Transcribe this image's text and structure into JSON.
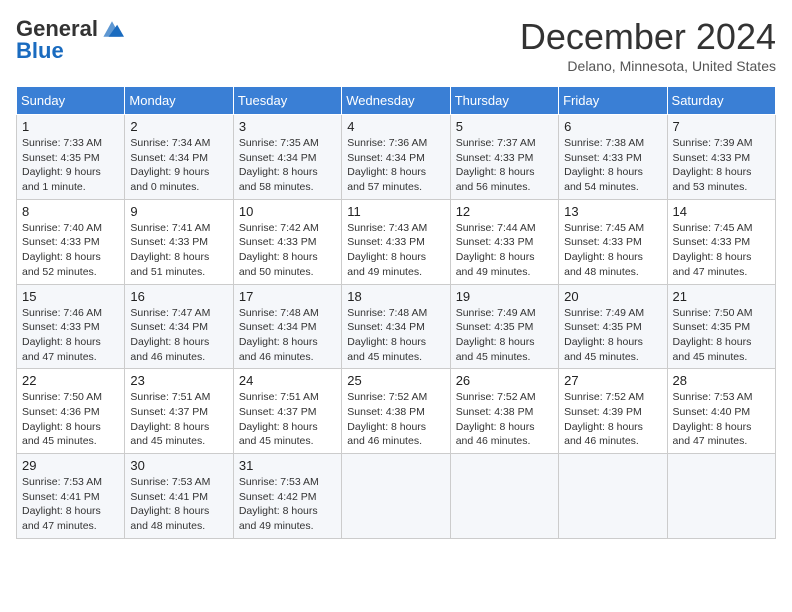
{
  "header": {
    "logo_general": "General",
    "logo_blue": "Blue",
    "month_title": "December 2024",
    "location": "Delano, Minnesota, United States"
  },
  "days_of_week": [
    "Sunday",
    "Monday",
    "Tuesday",
    "Wednesday",
    "Thursday",
    "Friday",
    "Saturday"
  ],
  "weeks": [
    [
      {
        "day": "1",
        "sunrise": "7:33 AM",
        "sunset": "4:35 PM",
        "daylight": "9 hours and 1 minute."
      },
      {
        "day": "2",
        "sunrise": "7:34 AM",
        "sunset": "4:34 PM",
        "daylight": "9 hours and 0 minutes."
      },
      {
        "day": "3",
        "sunrise": "7:35 AM",
        "sunset": "4:34 PM",
        "daylight": "8 hours and 58 minutes."
      },
      {
        "day": "4",
        "sunrise": "7:36 AM",
        "sunset": "4:34 PM",
        "daylight": "8 hours and 57 minutes."
      },
      {
        "day": "5",
        "sunrise": "7:37 AM",
        "sunset": "4:33 PM",
        "daylight": "8 hours and 56 minutes."
      },
      {
        "day": "6",
        "sunrise": "7:38 AM",
        "sunset": "4:33 PM",
        "daylight": "8 hours and 54 minutes."
      },
      {
        "day": "7",
        "sunrise": "7:39 AM",
        "sunset": "4:33 PM",
        "daylight": "8 hours and 53 minutes."
      }
    ],
    [
      {
        "day": "8",
        "sunrise": "7:40 AM",
        "sunset": "4:33 PM",
        "daylight": "8 hours and 52 minutes."
      },
      {
        "day": "9",
        "sunrise": "7:41 AM",
        "sunset": "4:33 PM",
        "daylight": "8 hours and 51 minutes."
      },
      {
        "day": "10",
        "sunrise": "7:42 AM",
        "sunset": "4:33 PM",
        "daylight": "8 hours and 50 minutes."
      },
      {
        "day": "11",
        "sunrise": "7:43 AM",
        "sunset": "4:33 PM",
        "daylight": "8 hours and 49 minutes."
      },
      {
        "day": "12",
        "sunrise": "7:44 AM",
        "sunset": "4:33 PM",
        "daylight": "8 hours and 49 minutes."
      },
      {
        "day": "13",
        "sunrise": "7:45 AM",
        "sunset": "4:33 PM",
        "daylight": "8 hours and 48 minutes."
      },
      {
        "day": "14",
        "sunrise": "7:45 AM",
        "sunset": "4:33 PM",
        "daylight": "8 hours and 47 minutes."
      }
    ],
    [
      {
        "day": "15",
        "sunrise": "7:46 AM",
        "sunset": "4:33 PM",
        "daylight": "8 hours and 47 minutes."
      },
      {
        "day": "16",
        "sunrise": "7:47 AM",
        "sunset": "4:34 PM",
        "daylight": "8 hours and 46 minutes."
      },
      {
        "day": "17",
        "sunrise": "7:48 AM",
        "sunset": "4:34 PM",
        "daylight": "8 hours and 46 minutes."
      },
      {
        "day": "18",
        "sunrise": "7:48 AM",
        "sunset": "4:34 PM",
        "daylight": "8 hours and 45 minutes."
      },
      {
        "day": "19",
        "sunrise": "7:49 AM",
        "sunset": "4:35 PM",
        "daylight": "8 hours and 45 minutes."
      },
      {
        "day": "20",
        "sunrise": "7:49 AM",
        "sunset": "4:35 PM",
        "daylight": "8 hours and 45 minutes."
      },
      {
        "day": "21",
        "sunrise": "7:50 AM",
        "sunset": "4:35 PM",
        "daylight": "8 hours and 45 minutes."
      }
    ],
    [
      {
        "day": "22",
        "sunrise": "7:50 AM",
        "sunset": "4:36 PM",
        "daylight": "8 hours and 45 minutes."
      },
      {
        "day": "23",
        "sunrise": "7:51 AM",
        "sunset": "4:37 PM",
        "daylight": "8 hours and 45 minutes."
      },
      {
        "day": "24",
        "sunrise": "7:51 AM",
        "sunset": "4:37 PM",
        "daylight": "8 hours and 45 minutes."
      },
      {
        "day": "25",
        "sunrise": "7:52 AM",
        "sunset": "4:38 PM",
        "daylight": "8 hours and 46 minutes."
      },
      {
        "day": "26",
        "sunrise": "7:52 AM",
        "sunset": "4:38 PM",
        "daylight": "8 hours and 46 minutes."
      },
      {
        "day": "27",
        "sunrise": "7:52 AM",
        "sunset": "4:39 PM",
        "daylight": "8 hours and 46 minutes."
      },
      {
        "day": "28",
        "sunrise": "7:53 AM",
        "sunset": "4:40 PM",
        "daylight": "8 hours and 47 minutes."
      }
    ],
    [
      {
        "day": "29",
        "sunrise": "7:53 AM",
        "sunset": "4:41 PM",
        "daylight": "8 hours and 47 minutes."
      },
      {
        "day": "30",
        "sunrise": "7:53 AM",
        "sunset": "4:41 PM",
        "daylight": "8 hours and 48 minutes."
      },
      {
        "day": "31",
        "sunrise": "7:53 AM",
        "sunset": "4:42 PM",
        "daylight": "8 hours and 49 minutes."
      },
      null,
      null,
      null,
      null
    ]
  ]
}
